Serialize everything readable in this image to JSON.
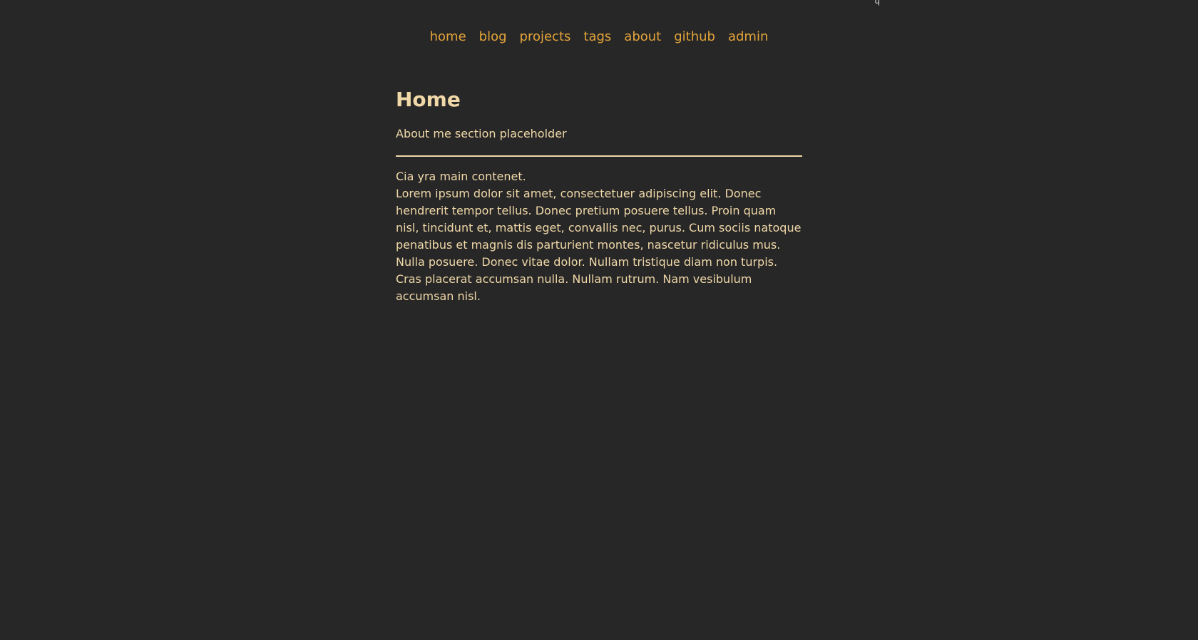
{
  "nav": {
    "items": [
      {
        "label": "home"
      },
      {
        "label": "blog"
      },
      {
        "label": "projects"
      },
      {
        "label": "tags"
      },
      {
        "label": "about"
      },
      {
        "label": "github"
      },
      {
        "label": "admin"
      }
    ]
  },
  "main": {
    "title": "Home",
    "about_text": "About me section placeholder",
    "intro": "Cia yra main contenet.",
    "body": "Lorem ipsum dolor sit amet, consectetuer adipiscing elit. Donec hendrerit tempor tellus. Donec pretium posuere tellus. Proin quam nisl, tincidunt et, mattis eget, convallis nec, purus. Cum sociis natoque penatibus et magnis dis parturient montes, nascetur ridiculus mus. Nulla posuere. Donec vitae dolor. Nullam tristique diam non turpis. Cras placerat accumsan nulla. Nullam rutrum. Nam vesibulum accumsan nisl."
  },
  "colors": {
    "background": "#272727",
    "link": "#e3a43a",
    "text": "#f0d8a8"
  }
}
